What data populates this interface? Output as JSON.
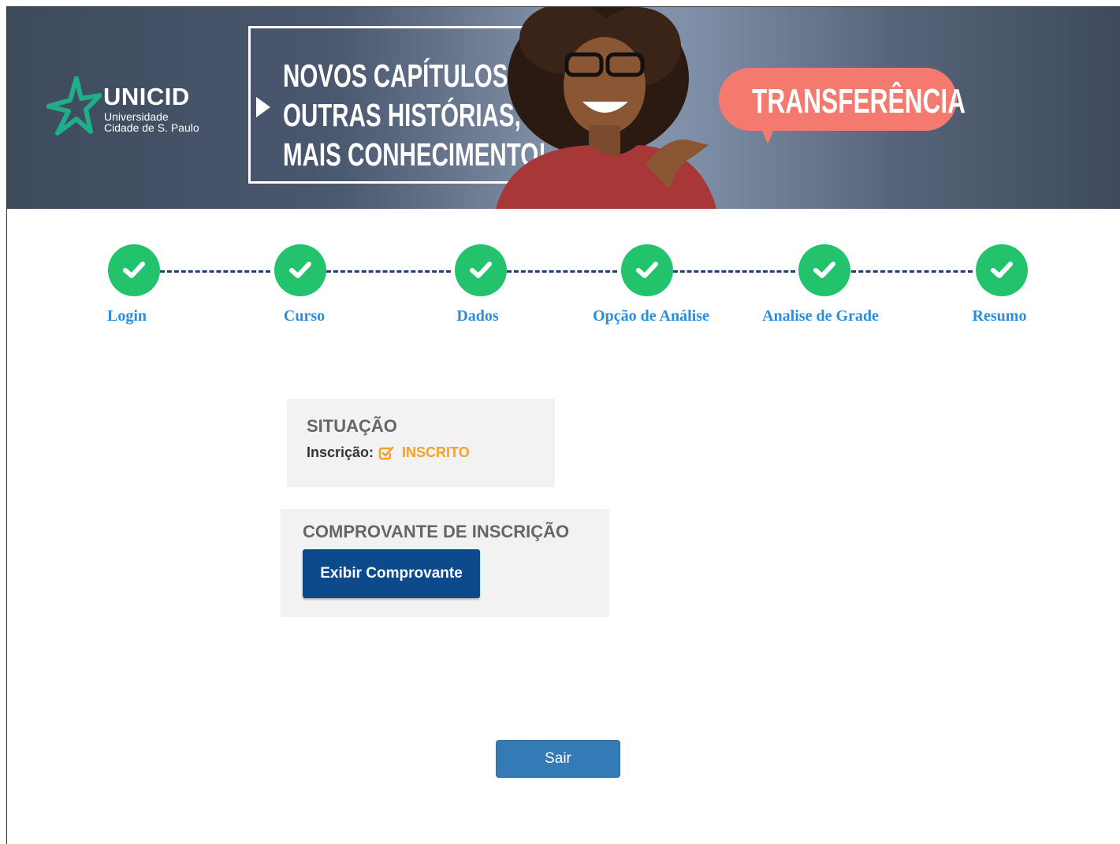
{
  "banner": {
    "logo_name": "UNICID",
    "logo_sub1": "Universidade",
    "logo_sub2": "Cidade de S. Paulo",
    "headline_lines": [
      "NOVOS CAPÍTULOS,",
      "OUTRAS HISTÓRIAS,",
      "MAIS CONHECIMENTO!"
    ],
    "bubble_text": "TRANSFERÊNCIA"
  },
  "steps": [
    {
      "label": "Login",
      "status": "complete"
    },
    {
      "label": "Curso",
      "status": "complete"
    },
    {
      "label": "Dados",
      "status": "complete"
    },
    {
      "label": "Opção de Análise",
      "status": "complete"
    },
    {
      "label": "Analise de Grade",
      "status": "complete"
    },
    {
      "label": "Resumo",
      "status": "complete"
    }
  ],
  "situacao": {
    "title": "SITUAÇÃO",
    "label": "Inscrição:",
    "value": "INSCRITO"
  },
  "comprovante": {
    "title": "COMPROVANTE DE INSCRIÇÃO",
    "button": "Exibir Comprovante"
  },
  "exit_button": "Sair",
  "colors": {
    "step_complete": "#22c36c",
    "step_label": "#2a8ee0",
    "connector": "#1f3b78",
    "status_value": "#f5a126",
    "primary_button": "#0c4a8c",
    "exit_button": "#337ab7"
  }
}
